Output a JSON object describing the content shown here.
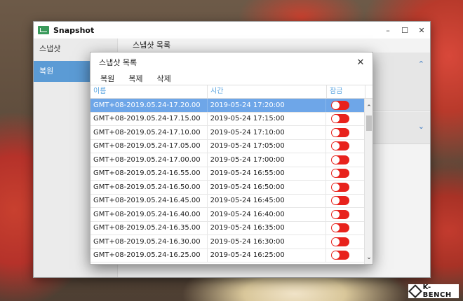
{
  "window": {
    "title": "Snapshot",
    "controls": {
      "minimize": "–",
      "maximize": "☐",
      "close": "✕"
    }
  },
  "sidebar": {
    "items": [
      {
        "label": "스냅샷"
      },
      {
        "label": "복원"
      }
    ]
  },
  "content": {
    "title": "스냅샷 목록",
    "panel_chevrons": [
      "⌃",
      "⌄"
    ]
  },
  "dialog": {
    "title": "스냅샷 목록",
    "close": "✕",
    "menu": [
      "복원",
      "복제",
      "삭제"
    ],
    "columns": [
      "이름",
      "시간",
      "잠금"
    ],
    "rows": [
      {
        "name": "GMT+08-2019.05.24-17.20.00",
        "time": "2019-05-24 17:20:00",
        "locked": false
      },
      {
        "name": "GMT+08-2019.05.24-17.15.00",
        "time": "2019-05-24 17:15:00",
        "locked": false
      },
      {
        "name": "GMT+08-2019.05.24-17.10.00",
        "time": "2019-05-24 17:10:00",
        "locked": false
      },
      {
        "name": "GMT+08-2019.05.24-17.05.00",
        "time": "2019-05-24 17:05:00",
        "locked": false
      },
      {
        "name": "GMT+08-2019.05.24-17.00.00",
        "time": "2019-05-24 17:00:00",
        "locked": false
      },
      {
        "name": "GMT+08-2019.05.24-16.55.00",
        "time": "2019-05-24 16:55:00",
        "locked": false
      },
      {
        "name": "GMT+08-2019.05.24-16.50.00",
        "time": "2019-05-24 16:50:00",
        "locked": false
      },
      {
        "name": "GMT+08-2019.05.24-16.45.00",
        "time": "2019-05-24 16:45:00",
        "locked": false
      },
      {
        "name": "GMT+08-2019.05.24-16.40.00",
        "time": "2019-05-24 16:40:00",
        "locked": false
      },
      {
        "name": "GMT+08-2019.05.24-16.35.00",
        "time": "2019-05-24 16:35:00",
        "locked": false
      },
      {
        "name": "GMT+08-2019.05.24-16.30.00",
        "time": "2019-05-24 16:30:00",
        "locked": false
      },
      {
        "name": "GMT+08-2019.05.24-16.25.00",
        "time": "2019-05-24 16:25:00",
        "locked": false
      }
    ],
    "selected_row": 0,
    "scroll_up": "⌃",
    "scroll_down": "⌄"
  },
  "logo": {
    "text": "K-BENCH"
  },
  "colors": {
    "accent": "#5b9bd5",
    "selected_row": "#6ea6e8",
    "toggle": "#e8221c",
    "header_text": "#5aa4e0"
  }
}
